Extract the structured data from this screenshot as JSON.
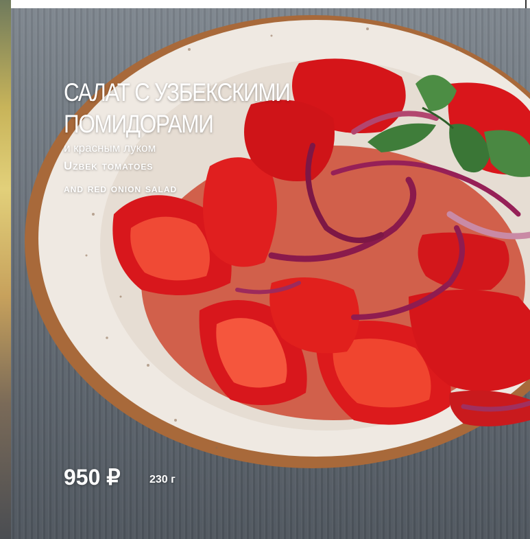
{
  "menu_item": {
    "title_line1": "САЛАТ С УЗБЕКСКИМИ",
    "title_line2": "ПОМИДОРАМИ",
    "subtitle_ru": "и красным луком",
    "subtitle_en_line1": "Uzbek tomatoes",
    "subtitle_en_line2": "and red onion salad",
    "price": "950 ₽",
    "weight": "230 г"
  },
  "colors": {
    "tomato": "#d8171c",
    "onion": "#8a1a4c",
    "mint": "#3f7d3a",
    "bowl": "#efe9e2",
    "text": "#ffffff"
  }
}
